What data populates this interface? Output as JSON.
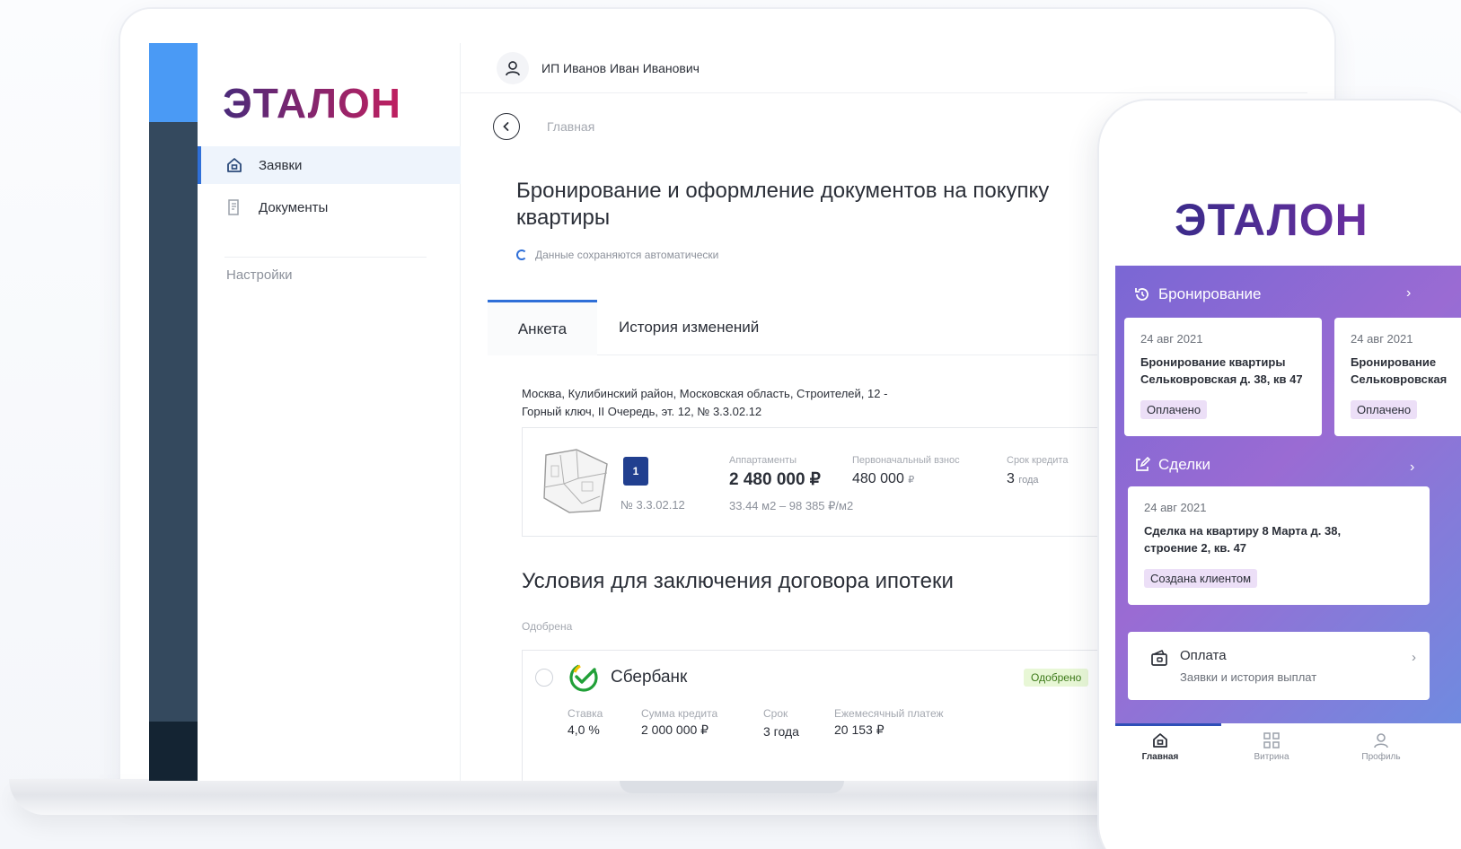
{
  "desktop": {
    "brand": "ЭТАЛОН",
    "sidebar": {
      "items": [
        {
          "label": "Заявки",
          "icon": "home-icon"
        },
        {
          "label": "Документы",
          "icon": "document-icon"
        }
      ],
      "settings_label": "Настройки"
    },
    "user": {
      "name": "ИП Иванов Иван Иванович"
    },
    "breadcrumb": "Главная",
    "page_title": "Бронирование и оформление документов на покупку квартиры",
    "autosave_text": "Данные сохраняются автоматически",
    "tabs": [
      {
        "label": "Анкета",
        "active": true
      },
      {
        "label": "История изменений",
        "active": false
      }
    ],
    "address_line1": "Москва, Кулибинский район, Московская область, Строителей, 12 -",
    "address_line2": "Горный ключ, II Очередь, эт. 12, № 3.3.02.12",
    "apartment": {
      "badge": "1",
      "number": "№ 3.3.02.12",
      "type_label": "Аппартаменты",
      "price": "2 480 000 ₽",
      "area_price": "33.44 м2 – 98 385 ₽/м2",
      "down_payment_label": "Первоначальный взнос",
      "down_payment_value": "480 000",
      "down_payment_currency": "₽",
      "term_label": "Срок кредита",
      "term_value": "3",
      "term_unit": "года"
    },
    "mortgage": {
      "title": "Условия для заключения договора ипотеки",
      "status_label": "Одобрена",
      "bank": {
        "name": "Сбербанк",
        "badge": "Одобрено",
        "rate_label": "Ставка",
        "rate_value": "4,0 %",
        "amount_label": "Сумма кредита",
        "amount_value": "2 000 000 ₽",
        "term_label": "Срок",
        "term_value": "3 года",
        "monthly_label": "Ежемесячный платеж",
        "monthly_value": "20 153 ₽"
      }
    }
  },
  "mobile": {
    "brand": "ЭТАЛОН",
    "booking": {
      "title": "Бронирование",
      "cards": [
        {
          "date": "24 авг 2021",
          "title_line1": "Бронирование квартиры",
          "title_line2": "Сельковровская д. 38, кв 47",
          "status": "Оплачено"
        },
        {
          "date": "24 авг 2021",
          "title_line1": "Бронирование",
          "title_line2": "Сельковровская",
          "status": "Оплачено"
        }
      ]
    },
    "deals": {
      "title": "Сделки",
      "card": {
        "date": "24 авг 2021",
        "title_line1": "Сделка на квартиру 8 Марта д. 38,",
        "title_line2": "строение 2, кв. 47",
        "status": "Создана клиентом"
      }
    },
    "payment": {
      "title": "Оплата",
      "subtitle": "Заявки и история выплат"
    },
    "tabbar": [
      {
        "label": "Главная",
        "icon": "home-icon",
        "active": true
      },
      {
        "label": "Витрина",
        "icon": "grid-icon",
        "active": false
      },
      {
        "label": "Профиль",
        "icon": "user-icon",
        "active": false
      }
    ]
  },
  "colors": {
    "accent_blue": "#2f6fd8",
    "rail": "#34495e",
    "rail_top": "#4a9af5",
    "purple_gradient_start": "#7a67d4",
    "purple_gradient_end": "#6f8be0",
    "approved_green": "#e8f7d6"
  }
}
